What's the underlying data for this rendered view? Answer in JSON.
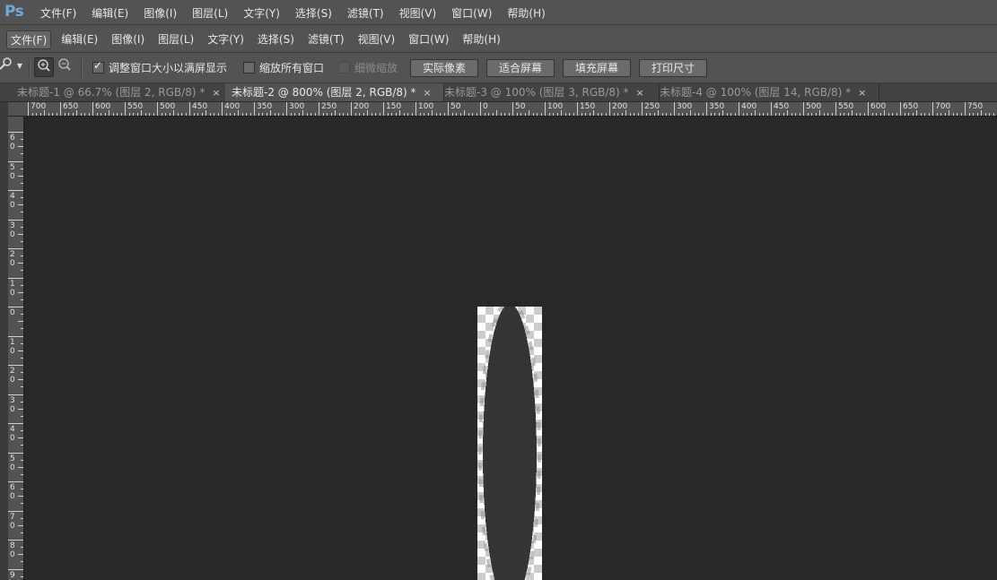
{
  "app": {
    "logo": "Ps",
    "top_menu": [
      "文件(F)",
      "编辑(E)",
      "图像(I)",
      "图层(L)",
      "文字(Y)",
      "选择(S)",
      "滤镜(T)",
      "视图(V)",
      "窗口(W)",
      "帮助(H)"
    ]
  },
  "menubar": {
    "items": [
      "文件(F)",
      "编辑(E)",
      "图像(I)",
      "图层(L)",
      "文字(Y)",
      "选择(S)",
      "滤镜(T)",
      "视图(V)",
      "窗口(W)",
      "帮助(H)"
    ],
    "active_index": 0
  },
  "options": {
    "resize_windows_label": "调整窗口大小以满屏显示",
    "resize_windows_checked": true,
    "zoom_all_label": "缩放所有窗口",
    "zoom_all_checked": false,
    "scrubby_zoom_label": "细微缩放",
    "scrubby_zoom_enabled": false,
    "btn_actual_pixels": "实际像素",
    "btn_fit_screen": "适合屏幕",
    "btn_fill_screen": "填充屏幕",
    "btn_print_size": "打印尺寸"
  },
  "tabs": [
    {
      "label": "未标题-1 @ 66.7% (图层 2, RGB/8) *",
      "close": "×",
      "active": false
    },
    {
      "label": "未标题-2 @ 800% (图层 2, RGB/8) *",
      "close": "×",
      "active": true
    },
    {
      "label": "未标题-3 @ 100% (图层 3, RGB/8) *",
      "close": "×",
      "active": false
    },
    {
      "label": "未标题-4 @ 100% (图层 14, RGB/8) *",
      "close": "×",
      "active": false
    }
  ],
  "ruler": {
    "h_labels": [
      "700",
      "650",
      "600",
      "550",
      "500",
      "450",
      "400",
      "350",
      "300",
      "250",
      "200",
      "150",
      "100",
      "50",
      "0",
      "50",
      "100",
      "150",
      "200",
      "250",
      "300",
      "350",
      "400",
      "450",
      "500",
      "550",
      "600",
      "650",
      "700",
      "750"
    ],
    "v_labels": [
      "6 0",
      "5 0",
      "4 0",
      "3 0",
      "2 0",
      "1 0",
      "0",
      "1 0",
      "2 0",
      "3 0",
      "4 0",
      "5 0",
      "6 0",
      "7 0",
      "8 0",
      "9"
    ]
  },
  "colors": {
    "panel": "#535353",
    "canvas": "#282828",
    "shape": "#343434",
    "checker_light": "#ffffff",
    "checker_dark": "#cccccc",
    "logo": "#6fa8dc"
  },
  "icons": {
    "tool": "zoom-tool-icon",
    "zoom_in": "zoom-in-icon",
    "zoom_out": "zoom-out-icon"
  }
}
